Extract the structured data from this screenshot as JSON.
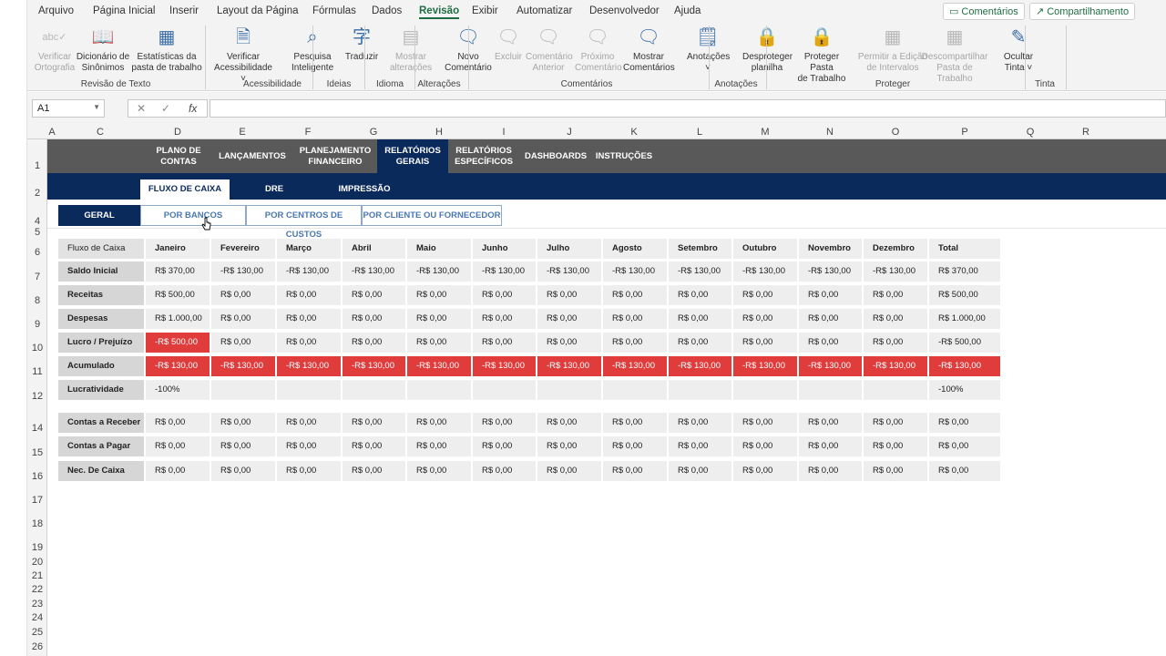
{
  "menu": {
    "tabs": [
      "Arquivo",
      "Página Inicial",
      "Inserir",
      "Layout da Página",
      "Fórmulas",
      "Dados",
      "Revisão",
      "Exibir",
      "Automatizar",
      "Desenvolvedor",
      "Ajuda"
    ],
    "active_tab": "Revisão",
    "comments_btn": "Comentários",
    "share_btn": "Compartilhamento"
  },
  "ribbon": {
    "buttons": [
      {
        "label": "Verificar\nOrtografia",
        "icon": "spellcheck-icon",
        "disabled": true
      },
      {
        "label": "Dicionário de\nSinônimos",
        "icon": "thesaurus-icon",
        "disabled": false
      },
      {
        "label": "Estatísticas da\npasta de trabalho",
        "icon": "workbook-stats-icon",
        "disabled": false
      },
      {
        "label": "Verificar\nAcessibilidade ˅",
        "icon": "accessibility-icon",
        "disabled": false
      },
      {
        "label": "Pesquisa\nInteligente",
        "icon": "smart-lookup-icon",
        "disabled": false
      },
      {
        "label": "Traduzir",
        "icon": "translate-icon",
        "disabled": false
      },
      {
        "label": "Mostrar\nalterações",
        "icon": "show-changes-icon",
        "disabled": true
      },
      {
        "label": "Novo\nComentário",
        "icon": "new-comment-icon",
        "disabled": false
      },
      {
        "label": "Excluir",
        "icon": "delete-comment-icon",
        "disabled": true
      },
      {
        "label": "Comentário\nAnterior",
        "icon": "previous-comment-icon",
        "disabled": true
      },
      {
        "label": "Próximo\nComentário",
        "icon": "next-comment-icon",
        "disabled": true
      },
      {
        "label": "Mostrar\nComentários",
        "icon": "show-comments-icon",
        "disabled": false
      },
      {
        "label": "Anotações\n˅",
        "icon": "notes-icon",
        "disabled": false
      },
      {
        "label": "Desproteger\nplanilha",
        "icon": "unprotect-sheet-icon",
        "disabled": false
      },
      {
        "label": "Proteger Pasta\nde Trabalho",
        "icon": "protect-workbook-icon",
        "disabled": false
      },
      {
        "label": "Permitir a Edição\nde Intervalos",
        "icon": "allow-edit-ranges-icon",
        "disabled": true
      },
      {
        "label": "Descompartilhar\nPasta de Trabalho",
        "icon": "unshare-workbook-icon",
        "disabled": true
      },
      {
        "label": "Ocultar\nTinta ˅",
        "icon": "hide-ink-icon",
        "disabled": false
      }
    ],
    "groups": [
      "Revisão de Texto",
      "Acessibilidade",
      "Ideias",
      "Idioma",
      "Alterações",
      "Comentários",
      "Anotações",
      "Proteger",
      "Tinta"
    ]
  },
  "formula_bar": {
    "name_box": "A1",
    "cancel": "✕",
    "enter": "✓",
    "fx": "fx",
    "formula": ""
  },
  "columns": [
    "A",
    "C",
    "D",
    "E",
    "F",
    "G",
    "H",
    "I",
    "J",
    "K",
    "L",
    "M",
    "N",
    "O",
    "P",
    "Q",
    "R"
  ],
  "rows": [
    "1",
    "2",
    "4",
    "5",
    "6",
    "7",
    "8",
    "9",
    "10",
    "11",
    "12",
    "14",
    "15",
    "16",
    "17",
    "18",
    "19",
    "20",
    "21",
    "22",
    "23",
    "24",
    "25",
    "26"
  ],
  "nav": {
    "items": [
      "PLANO DE\nCONTAS",
      "LANÇAMENTOS",
      "PLANEJAMENTO\nFINANCEIRO",
      "RELATÓRIOS\nGERAIS",
      "RELATÓRIOS\nESPECÍFICOS",
      "DASHBOARDS",
      "INSTRUÇÕES"
    ],
    "active": "RELATÓRIOS\nGERAIS"
  },
  "subnav": {
    "items": [
      "FLUXO DE CAIXA",
      "DRE",
      "IMPRESSÃO"
    ],
    "active": "FLUXO DE CAIXA"
  },
  "filters": {
    "items": [
      "GERAL",
      "POR BANCOS",
      "POR CENTROS DE CUSTOS",
      "POR CLIENTE OU FORNECEDOR"
    ],
    "active": "GERAL"
  },
  "table": {
    "header": [
      "Fluxo de Caixa",
      "Janeiro",
      "Fevereiro",
      "Março",
      "Abril",
      "Maio",
      "Junho",
      "Julho",
      "Agosto",
      "Setembro",
      "Outubro",
      "Novembro",
      "Dezembro",
      "Total"
    ],
    "rows": [
      {
        "label": "Saldo Inicial",
        "values": [
          "R$ 370,00",
          "-R$ 130,00",
          "-R$ 130,00",
          "-R$ 130,00",
          "-R$ 130,00",
          "-R$ 130,00",
          "-R$ 130,00",
          "-R$ 130,00",
          "-R$ 130,00",
          "-R$ 130,00",
          "-R$ 130,00",
          "-R$ 130,00",
          "R$ 370,00"
        ],
        "neg": []
      },
      {
        "label": "Receitas",
        "values": [
          "R$ 500,00",
          "R$ 0,00",
          "R$ 0,00",
          "R$ 0,00",
          "R$ 0,00",
          "R$ 0,00",
          "R$ 0,00",
          "R$ 0,00",
          "R$ 0,00",
          "R$ 0,00",
          "R$ 0,00",
          "R$ 0,00",
          "R$ 500,00"
        ],
        "neg": []
      },
      {
        "label": "Despesas",
        "values": [
          "R$ 1.000,00",
          "R$ 0,00",
          "R$ 0,00",
          "R$ 0,00",
          "R$ 0,00",
          "R$ 0,00",
          "R$ 0,00",
          "R$ 0,00",
          "R$ 0,00",
          "R$ 0,00",
          "R$ 0,00",
          "R$ 0,00",
          "R$ 1.000,00"
        ],
        "neg": []
      },
      {
        "label": "Lucro / Prejuízo",
        "values": [
          "-R$ 500,00",
          "R$ 0,00",
          "R$ 0,00",
          "R$ 0,00",
          "R$ 0,00",
          "R$ 0,00",
          "R$ 0,00",
          "R$ 0,00",
          "R$ 0,00",
          "R$ 0,00",
          "R$ 0,00",
          "R$ 0,00",
          "-R$ 500,00"
        ],
        "neg": [
          0
        ]
      },
      {
        "label": "Acumulado",
        "values": [
          "-R$ 130,00",
          "-R$ 130,00",
          "-R$ 130,00",
          "-R$ 130,00",
          "-R$ 130,00",
          "-R$ 130,00",
          "-R$ 130,00",
          "-R$ 130,00",
          "-R$ 130,00",
          "-R$ 130,00",
          "-R$ 130,00",
          "-R$ 130,00",
          "-R$ 130,00"
        ],
        "neg": [
          0,
          1,
          2,
          3,
          4,
          5,
          6,
          7,
          8,
          9,
          10,
          11,
          12
        ]
      },
      {
        "label": "Lucratividade",
        "values": [
          "-100%",
          "",
          "",
          "",
          "",
          "",
          "",
          "",
          "",
          "",
          "",
          "",
          "-100%"
        ],
        "neg": []
      }
    ],
    "rows2": [
      {
        "label": "Contas a Receber",
        "values": [
          "R$ 0,00",
          "R$ 0,00",
          "R$ 0,00",
          "R$ 0,00",
          "R$ 0,00",
          "R$ 0,00",
          "R$ 0,00",
          "R$ 0,00",
          "R$ 0,00",
          "R$ 0,00",
          "R$ 0,00",
          "R$ 0,00",
          "R$ 0,00"
        ]
      },
      {
        "label": "Contas a Pagar",
        "values": [
          "R$ 0,00",
          "R$ 0,00",
          "R$ 0,00",
          "R$ 0,00",
          "R$ 0,00",
          "R$ 0,00",
          "R$ 0,00",
          "R$ 0,00",
          "R$ 0,00",
          "R$ 0,00",
          "R$ 0,00",
          "R$ 0,00",
          "R$ 0,00"
        ]
      },
      {
        "label": "Nec. De Caixa",
        "values": [
          "R$ 0,00",
          "R$ 0,00",
          "R$ 0,00",
          "R$ 0,00",
          "R$ 0,00",
          "R$ 0,00",
          "R$ 0,00",
          "R$ 0,00",
          "R$ 0,00",
          "R$ 0,00",
          "R$ 0,00",
          "R$ 0,00",
          "R$ 0,00"
        ]
      }
    ]
  },
  "colors": {
    "navy": "#0b2a5c",
    "nav_gray": "#595959",
    "negative_red": "#e03c3c",
    "excel_green": "#1f6e43"
  }
}
